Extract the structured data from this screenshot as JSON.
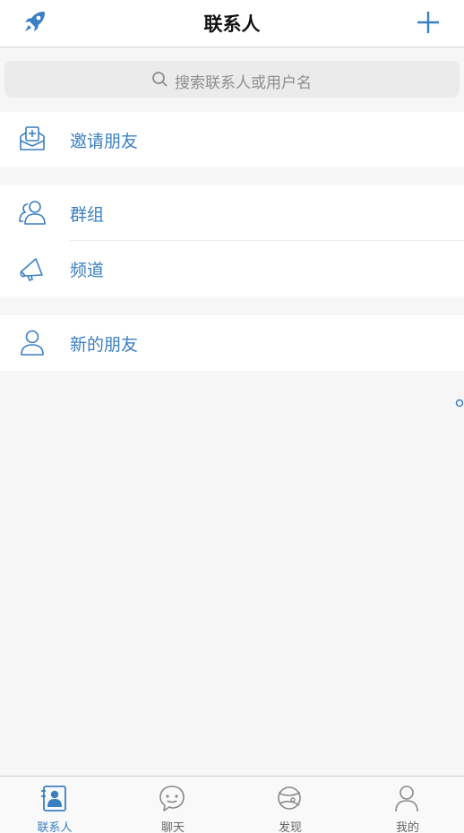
{
  "header": {
    "title": "联系人",
    "left_icon": "rocket-icon",
    "right_icon": "plus-icon"
  },
  "search": {
    "placeholder": "搜索联系人或用户名"
  },
  "groups": [
    [
      {
        "label": "邀请朋友",
        "icon": "invite-mail-icon"
      }
    ],
    [
      {
        "label": "群组",
        "icon": "group-icon"
      },
      {
        "label": "频道",
        "icon": "megaphone-icon"
      }
    ],
    [
      {
        "label": "新的朋友",
        "icon": "person-icon"
      }
    ]
  ],
  "tabbar": {
    "tabs": [
      {
        "label": "联系人",
        "icon": "contacts-icon",
        "active": true
      },
      {
        "label": "聊天",
        "icon": "chat-icon",
        "active": false
      },
      {
        "label": "发现",
        "icon": "discover-planet-icon",
        "active": false
      },
      {
        "label": "我的",
        "icon": "me-icon",
        "active": false
      }
    ]
  },
  "colors": {
    "accent": "#3a7fc1",
    "background": "#f6f6f6",
    "inactive": "#8a8a8a"
  }
}
